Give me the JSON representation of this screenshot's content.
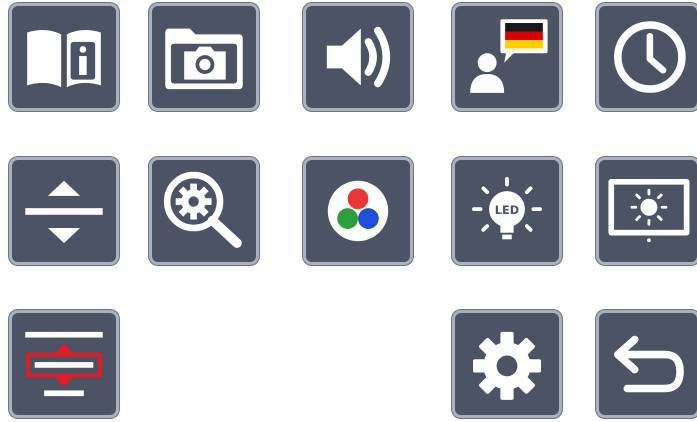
{
  "colors": {
    "tile_bg": "#4b5365",
    "tile_border": "#aab0bc",
    "icon": "#ffffff",
    "flag_black": "#1a1a1a",
    "flag_red": "#dd0000",
    "flag_gold": "#ffce00",
    "dot_red": "#e53935",
    "dot_green": "#2e9e3e",
    "dot_blue": "#1e4fd6",
    "highlight_red": "#e31b23"
  },
  "menu": {
    "rows": [
      [
        "manual",
        "photo-gallery",
        "volume",
        "language",
        "clock"
      ],
      [
        "line-spacing",
        "magnification-settings",
        "color-modes",
        "led-light",
        "screen-brightness"
      ],
      [
        "reading-line",
        "settings",
        "back"
      ]
    ],
    "led_icon_label": "LED"
  }
}
